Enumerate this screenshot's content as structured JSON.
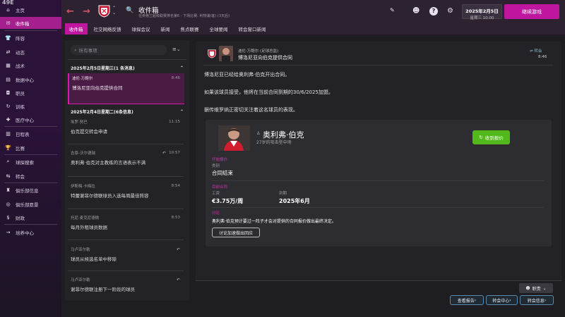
{
  "app_title": "49E",
  "sidebar": {
    "items": [
      {
        "label": "主页",
        "icon": "home-icon"
      },
      {
        "label": "收件箱",
        "icon": "mail-icon"
      },
      {
        "label": "阵容",
        "icon": "shirt-icon"
      },
      {
        "label": "动态",
        "icon": "activity-icon"
      },
      {
        "label": "战术",
        "icon": "tactics-icon"
      },
      {
        "label": "数据中心",
        "icon": "data-icon"
      },
      {
        "label": "职员",
        "icon": "staff-icon"
      },
      {
        "label": "训练",
        "icon": "training-icon"
      },
      {
        "label": "医疗中心",
        "icon": "medical-icon"
      },
      {
        "label": "日程表",
        "icon": "calendar-icon"
      },
      {
        "label": "比赛",
        "icon": "trophy-icon"
      },
      {
        "label": "球探搜索",
        "icon": "scout-icon"
      },
      {
        "label": "转会",
        "icon": "transfer-icon"
      },
      {
        "label": "俱乐部信息",
        "icon": "club-icon"
      },
      {
        "label": "俱乐部愿景",
        "icon": "vision-icon"
      },
      {
        "label": "财政",
        "icon": "finance-icon"
      },
      {
        "label": "培养中心",
        "icon": "development-icon"
      }
    ]
  },
  "header": {
    "title": "收件箱",
    "subtitle": "在英格兰超级联赛排名第6 - 下场比赛: 利物浦(客) (3天后)",
    "date": "2025年2月5日",
    "time": "星期三 10:00",
    "continue_label": "继续游戏"
  },
  "tabs": [
    "收件箱",
    "社交网络反馈",
    "球探会议",
    "新闻",
    "焦点联赛",
    "全球要闻",
    "转会窗口新闻"
  ],
  "inbox": {
    "search_placeholder": "所有事项",
    "groups": [
      {
        "header": "2025年2月5日星期三(1 条消息)",
        "messages": [
          {
            "from": "迪伦·万鲍尔",
            "subject": "博洛尼亚向伯克提供合同",
            "time": "8:46",
            "active": true,
            "reply": false
          }
        ]
      },
      {
        "header": "2025年2月4日星期二(6条信息)",
        "messages": [
          {
            "from": "埃罗·努巴",
            "subject": "伯克提交转会申请",
            "time": "11:15",
            "reply": false
          },
          {
            "from": "吉恩-沃尔德瑞",
            "subject": "奥利弗·伯克对主教练的言语表示不满",
            "time": "10:57",
            "reply": true
          },
          {
            "from": "伊斯梅·卡梅拉",
            "subject": "特蕾谢菲尔德联球员入选每周最佳阵容",
            "time": "8:54",
            "reply": false
          },
          {
            "from": "托尼·麦克尼德微",
            "subject": "每月外租球员数据",
            "time": "8:53",
            "reply": false
          },
          {
            "from": "马卢亚尔勒",
            "subject": "球员从候选名单中移除",
            "time": "",
            "reply": true
          },
          {
            "from": "马卢亚尔勒",
            "subject": "谢菲尔德联注册下一阶段的球员",
            "time": "",
            "reply": true
          }
        ]
      }
    ]
  },
  "message": {
    "sender": "迪伦·万鲍尔 (足球总监)",
    "subject": "博洛尼亚向伯克提供合同",
    "flag": "转会",
    "time": "8:46",
    "paragraphs": [
      "博洛尼亚已经给奥利弗·伯克开出合同。",
      "如果该球员接受，他将在当前合同到期的30/6/2025加盟。",
      "据传维罗纳正密切关注着这名球员的表现。"
    ],
    "player": {
      "name": "奥利弗·伯克",
      "desc": "27岁的攻击型中场",
      "offer_button": "收到报价"
    },
    "details": {
      "start_label": "开始报价",
      "type_label": "类别",
      "type_value": "合同结束",
      "current_label": "目前合同",
      "wage_label": "工资",
      "wage_value": "€3.75万/周",
      "expiry_label": "到期",
      "expiry_value": "2025年6月",
      "discuss_label": "讨论",
      "discuss_text": "奥利弗·伯克预计要过一阵子才会对提供的合同报价做出最终决定。",
      "discuss_button": "讨论加速做出回应"
    }
  },
  "footer": {
    "staff_button": "职责",
    "buttons": [
      "查看报告",
      "转会中心",
      "转会信息"
    ]
  },
  "colors": {
    "accent": "#c0169f",
    "offer": "#52b81b",
    "sidebar": "#2a1238"
  }
}
